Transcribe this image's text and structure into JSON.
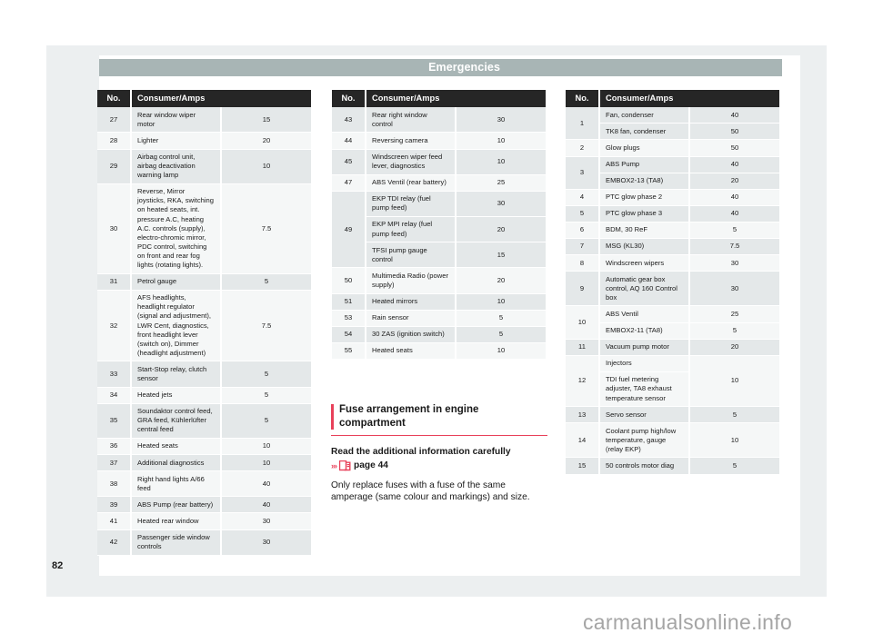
{
  "header": {
    "title": "Emergencies"
  },
  "folio": "82",
  "watermark": "carmanualsonline.info",
  "table_headers": {
    "no": "No.",
    "consumer": "Consumer/Amps"
  },
  "colors": {
    "header_band": "#a8b5b5",
    "table_header_bg": "#262626",
    "accent_red": "#e8415a",
    "row_shade": "#e4e8e9",
    "row_plain": "#f5f7f7",
    "page_bg": "#eceff0"
  },
  "column1": {
    "rows": [
      {
        "no": "27",
        "items": [
          {
            "desc": "Rear window wiper motor",
            "amps": "15"
          }
        ]
      },
      {
        "no": "28",
        "items": [
          {
            "desc": "Lighter",
            "amps": "20"
          }
        ]
      },
      {
        "no": "29",
        "items": [
          {
            "desc": "Airbag control unit, airbag deactivation warning lamp",
            "amps": "10"
          }
        ]
      },
      {
        "no": "30",
        "items": [
          {
            "desc": "Reverse, Mirror joysticks, RKA, switching on heated seats, int. pressure A.C, heating A.C. controls (supply), electro-chromic mirror, PDC control, switching on front and rear fog lights (rotating lights).",
            "amps": "7.5"
          }
        ]
      },
      {
        "no": "31",
        "items": [
          {
            "desc": "Petrol gauge",
            "amps": "5"
          }
        ]
      },
      {
        "no": "32",
        "items": [
          {
            "desc": "AFS headlights, headlight regulator (signal and adjustment), LWR Cent, diagnostics, front headlight lever (switch on), Dimmer (headlight adjustment)",
            "amps": "7.5"
          }
        ]
      },
      {
        "no": "33",
        "items": [
          {
            "desc": "Start-Stop relay, clutch sensor",
            "amps": "5"
          }
        ]
      },
      {
        "no": "34",
        "items": [
          {
            "desc": "Heated jets",
            "amps": "5"
          }
        ]
      },
      {
        "no": "35",
        "items": [
          {
            "desc": "Soundaktor control feed, GRA feed, Kühlerlüfter central feed",
            "amps": "5"
          }
        ]
      },
      {
        "no": "36",
        "items": [
          {
            "desc": "Heated seats",
            "amps": "10"
          }
        ]
      },
      {
        "no": "37",
        "items": [
          {
            "desc": "Additional diagnostics",
            "amps": "10"
          }
        ]
      },
      {
        "no": "38",
        "items": [
          {
            "desc": "Right hand lights A/66 feed",
            "amps": "40"
          }
        ]
      },
      {
        "no": "39",
        "items": [
          {
            "desc": "ABS Pump (rear battery)",
            "amps": "40"
          }
        ]
      },
      {
        "no": "41",
        "items": [
          {
            "desc": "Heated rear window",
            "amps": "30"
          }
        ]
      },
      {
        "no": "42",
        "items": [
          {
            "desc": "Passenger side window controls",
            "amps": "30"
          }
        ]
      }
    ]
  },
  "column2": {
    "rows": [
      {
        "no": "43",
        "items": [
          {
            "desc": "Rear right window control",
            "amps": "30"
          }
        ]
      },
      {
        "no": "44",
        "items": [
          {
            "desc": "Reversing camera",
            "amps": "10"
          }
        ]
      },
      {
        "no": "45",
        "items": [
          {
            "desc": "Windscreen wiper feed lever, diagnostics",
            "amps": "10"
          }
        ]
      },
      {
        "no": "47",
        "items": [
          {
            "desc": "ABS Ventil (rear battery)",
            "amps": "25"
          }
        ]
      },
      {
        "no": "49",
        "items": [
          {
            "desc": "EKP TDI relay (fuel pump feed)",
            "amps": "30"
          },
          {
            "desc": "EKP MPI relay (fuel pump feed)",
            "amps": "20"
          },
          {
            "desc": "TFSI pump gauge control",
            "amps": "15"
          }
        ]
      },
      {
        "no": "50",
        "items": [
          {
            "desc": "Multimedia Radio (power supply)",
            "amps": "20"
          }
        ]
      },
      {
        "no": "51",
        "items": [
          {
            "desc": "Heated mirrors",
            "amps": "10"
          }
        ]
      },
      {
        "no": "53",
        "items": [
          {
            "desc": "Rain sensor",
            "amps": "5"
          }
        ]
      },
      {
        "no": "54",
        "items": [
          {
            "desc": "30 ZAS (ignition switch)",
            "amps": "5"
          }
        ]
      },
      {
        "no": "55",
        "items": [
          {
            "desc": "Heated seats",
            "amps": "10"
          }
        ]
      }
    ]
  },
  "column3": {
    "rows": [
      {
        "no": "1",
        "items": [
          {
            "desc": "Fan, condenser",
            "amps": "40"
          },
          {
            "desc": "TK8 fan, condenser",
            "amps": "50"
          }
        ]
      },
      {
        "no": "2",
        "items": [
          {
            "desc": "Glow plugs",
            "amps": "50"
          }
        ]
      },
      {
        "no": "3",
        "items": [
          {
            "desc": "ABS Pump",
            "amps": "40"
          },
          {
            "desc": "EMBOX2-13 (TA8)",
            "amps": "20"
          }
        ]
      },
      {
        "no": "4",
        "items": [
          {
            "desc": "PTC glow phase 2",
            "amps": "40"
          }
        ]
      },
      {
        "no": "5",
        "items": [
          {
            "desc": "PTC glow phase 3",
            "amps": "40"
          }
        ]
      },
      {
        "no": "6",
        "items": [
          {
            "desc": "BDM, 30 ReF",
            "amps": "5"
          }
        ]
      },
      {
        "no": "7",
        "items": [
          {
            "desc": "MSG (KL30)",
            "amps": "7.5"
          }
        ]
      },
      {
        "no": "8",
        "items": [
          {
            "desc": "Windscreen wipers",
            "amps": "30"
          }
        ]
      },
      {
        "no": "9",
        "items": [
          {
            "desc": "Automatic gear box control, AQ 160 Control box",
            "amps": "30"
          }
        ]
      },
      {
        "no": "10",
        "items": [
          {
            "desc": "ABS Ventil",
            "amps": "25"
          },
          {
            "desc": "EMBOX2-11 (TA8)",
            "amps": "5"
          }
        ]
      },
      {
        "no": "11",
        "items": [
          {
            "desc": "Vacuum pump motor",
            "amps": "20"
          }
        ]
      },
      {
        "no": "12",
        "merged_amps": "10",
        "items": [
          {
            "desc": "Injectors",
            "amps": ""
          },
          {
            "desc": "TDI fuel metering adjuster, TA8 exhaust temperature sensor",
            "amps": ""
          }
        ]
      },
      {
        "no": "13",
        "items": [
          {
            "desc": "Servo sensor",
            "amps": "5"
          }
        ]
      },
      {
        "no": "14",
        "items": [
          {
            "desc": "Coolant pump high/low temperature, gauge (relay EKP)",
            "amps": "10"
          }
        ]
      },
      {
        "no": "15",
        "items": [
          {
            "desc": "50 controls motor diag",
            "amps": "5"
          }
        ]
      }
    ]
  },
  "info": {
    "title": "Fuse arrangement in engine compartment",
    "subtitle": "Read the additional information carefully",
    "chevron": "›››",
    "page_ref": "page 44",
    "icon": "booklet-icon",
    "body": "Only replace fuses with a fuse of the same amperage (same colour and markings) and size."
  }
}
